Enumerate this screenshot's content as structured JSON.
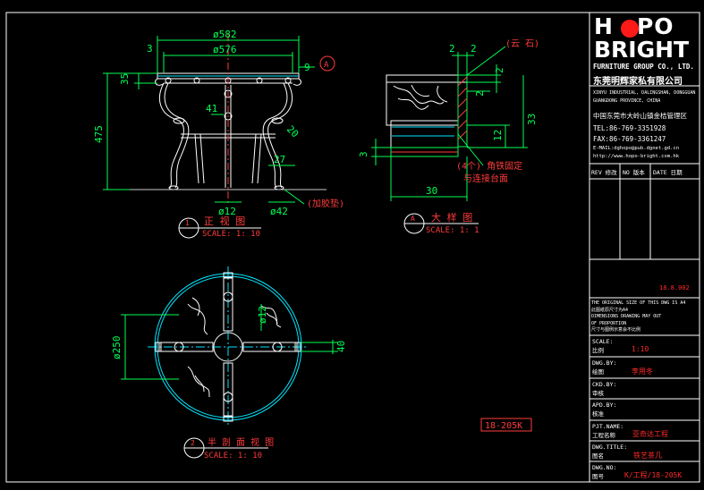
{
  "brand": {
    "word1a": "H",
    "word1b": "PO",
    "word2": "BRIGHT",
    "group": "FURNITURE GROUP CO., LTD.",
    "cn_name": "东莞明辉家私有限公司"
  },
  "contact": {
    "addr_en1": "XINYU INDUSTRIAL, DALINGSHAN, DONGGUAN",
    "addr_en2": "GUANGDONG PROVINCE, CHINA",
    "addr_cn": "中国东莞市大岭山镇金桔管理区",
    "tel": "TEL:86-769-3351928",
    "fax": "FAX:86-769-3361247",
    "email": "E-MAIL:dghopo@pub.dgnet.gd.cn",
    "web": "http://www.hopo-bright.com.hk"
  },
  "revision_header": {
    "rev": "REV 修改",
    "no": "NO 版本",
    "date": "DATE 日期"
  },
  "revision_date": "18.8.002",
  "notice": {
    "en1": "THE ORIGINAL SIZE OF THIS DWG IS A4",
    "cn1": "此图纸原尺寸为A4",
    "en2": "DIMENSIONS DRAWING MAY OUT",
    "en3": "OF PROPORTION",
    "cn2": "尺寸与图例示意会不比例"
  },
  "fields": [
    {
      "en": "SCALE:",
      "cn": "比例",
      "value": "1:10"
    },
    {
      "en": "DWG.BY:",
      "cn": "绘图",
      "value": "李用冬"
    },
    {
      "en": "CKD.BY:",
      "cn": "审核",
      "value": ""
    },
    {
      "en": "APD.BY:",
      "cn": "核准",
      "value": ""
    },
    {
      "en": "PJT.NAME:",
      "cn": "工程名称",
      "value": "亚奇达工程"
    },
    {
      "en": "DWG.TITLE:",
      "cn": "图名",
      "value": "铁艺茶几"
    },
    {
      "en": "DWG.NO:",
      "cn": "图号",
      "value": "K/工程/18-205K"
    }
  ],
  "code_box": "18-205K",
  "front_view": {
    "dims": {
      "d582": "ø582",
      "d576": "ø576",
      "d3": "3",
      "d9": "9",
      "d35": "35",
      "d475": "475",
      "d41": "41",
      "d20": "20",
      "d27": "27",
      "d12": "ø12",
      "d42": "ø42"
    },
    "bubble": "A",
    "note_pad": "(加胶垫)",
    "title": "正 视 图",
    "scale": "SCALE: 1: 10",
    "label_no": "1"
  },
  "detail_view": {
    "dims": {
      "d2a": "2",
      "d2b": "2",
      "d2c": "2",
      "d33": "33",
      "d12": "12",
      "d3": "3",
      "d30": "30"
    },
    "note_stone": "(云 石)",
    "note_fix1": "(4个) 角铁固定",
    "note_fix2": "与连接台面",
    "title": "大 样 图",
    "scale": "SCALE: 1: 1",
    "label_no": "A"
  },
  "plan_view": {
    "dims": {
      "d250": "ø250",
      "d12": "ø12",
      "d40": "40"
    },
    "title": "半 剖 面 视 图",
    "scale": "SCALE: 1: 10",
    "label_no": "2"
  }
}
